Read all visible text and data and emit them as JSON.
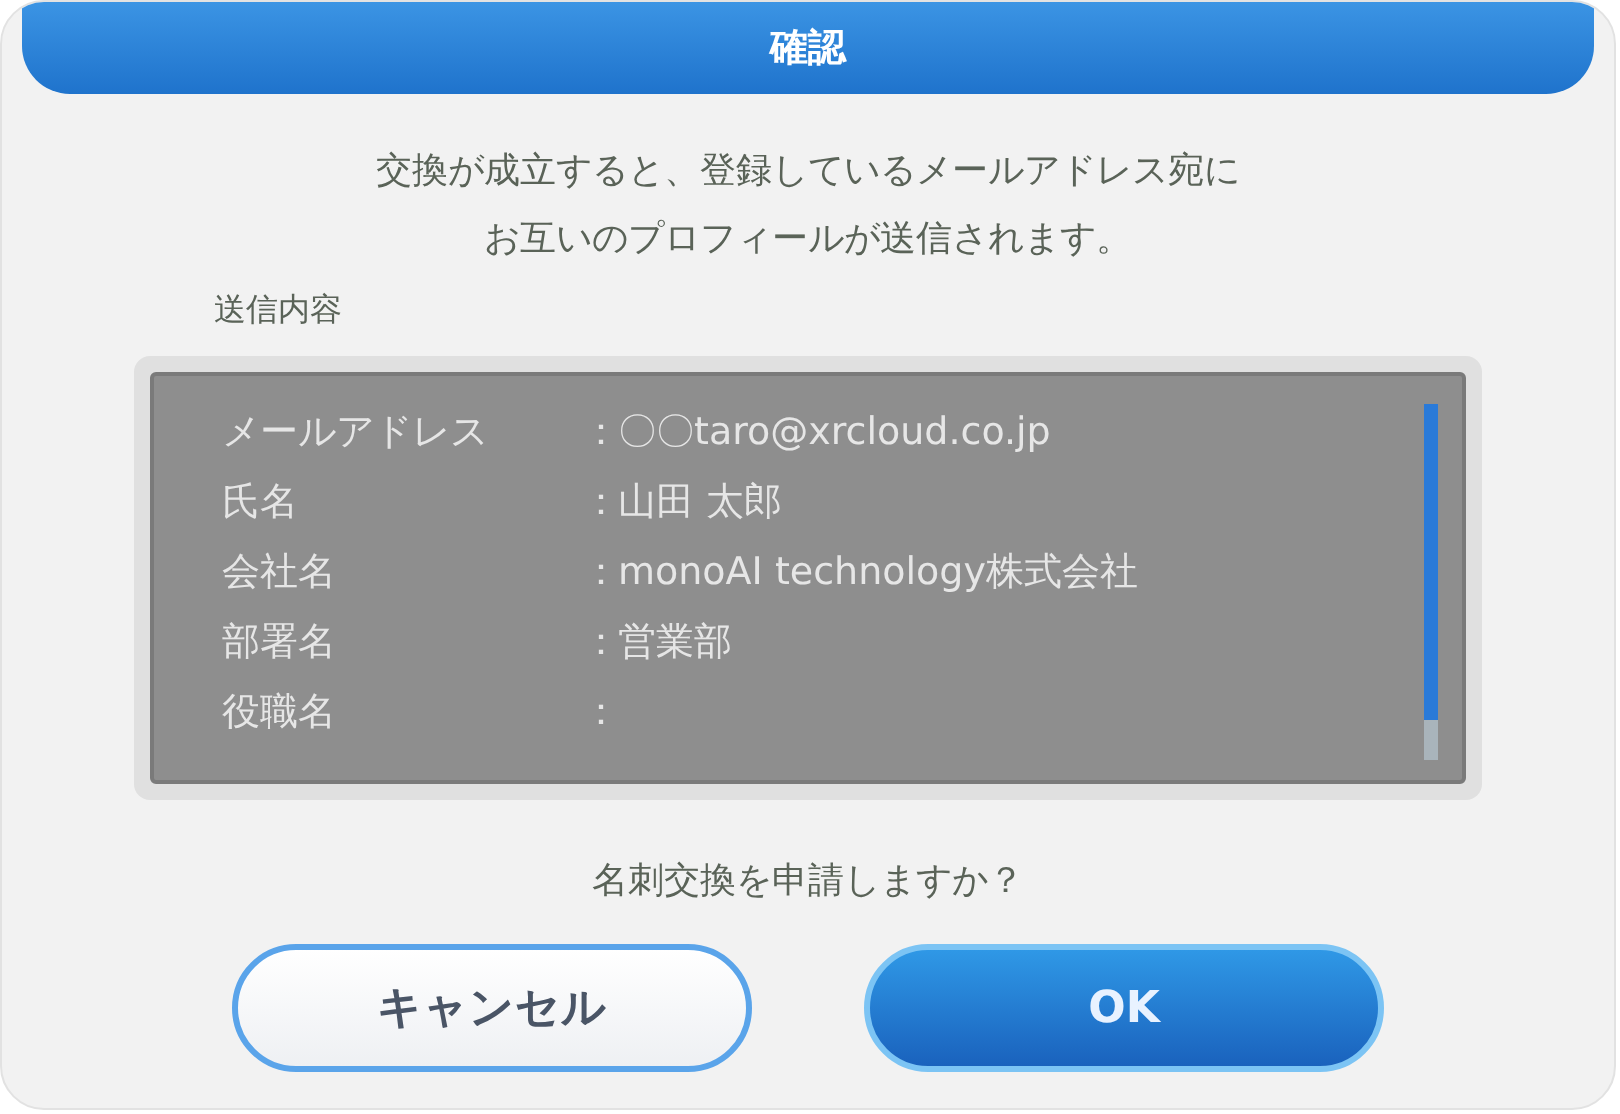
{
  "dialog": {
    "title": "確認",
    "message": [
      "交換が成立すると、登録しているメールアドレス宛に",
      "お互いのプロフィールが送信されます。"
    ],
    "section_label": "送信内容",
    "fields": [
      {
        "label": "メールアドレス",
        "separator": "：",
        "value": "〇〇taro@xrcloud.co.jp"
      },
      {
        "label": "氏名",
        "separator": "：",
        "value": "山田 太郎"
      },
      {
        "label": "会社名",
        "separator": "：",
        "value": "monoAI technology株式会社"
      },
      {
        "label": "部署名",
        "separator": "：",
        "value": "営業部"
      },
      {
        "label": "役職名",
        "separator": "："
      }
    ],
    "question": "名刺交換を申請しますか？",
    "buttons": [
      {
        "label": "キャンセル",
        "kind": "secondary"
      },
      {
        "label": "OK",
        "kind": "primary"
      }
    ]
  }
}
